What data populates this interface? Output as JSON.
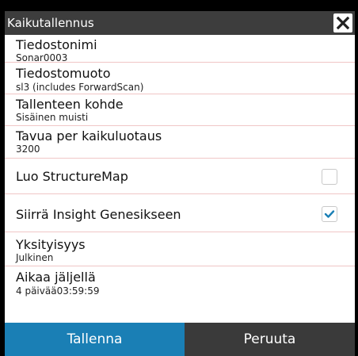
{
  "dialog": {
    "title": "Kaikutallennus"
  },
  "fields": {
    "filename": {
      "label": "Tiedostonimi",
      "value": "Sonar0003"
    },
    "format": {
      "label": "Tiedostomuoto",
      "value": "sl3 (includes ForwardScan)"
    },
    "destination": {
      "label": "Tallenteen kohde",
      "value": "Sisäinen muisti"
    },
    "bytes_per_sounding": {
      "label": "Tavua per kaikuluotaus",
      "value": "3200"
    },
    "create_structuremap": {
      "label": "Luo StructureMap",
      "checked": false
    },
    "transfer_genesis": {
      "label": "Siirrä Insight Genesikseen",
      "checked": true
    },
    "privacy": {
      "label": "Yksityisyys",
      "value": "Julkinen"
    },
    "time_left": {
      "label": "Aikaa jäljellä",
      "value": "4 päivää03:59:59"
    }
  },
  "buttons": {
    "save": "Tallenna",
    "cancel": "Peruuta"
  },
  "colors": {
    "titlebar": "#3d3d3d",
    "save": "#1a7fb5",
    "cancel": "#3a3a3a",
    "check": "#1a7fb5",
    "divider": "#f0c6c6"
  }
}
